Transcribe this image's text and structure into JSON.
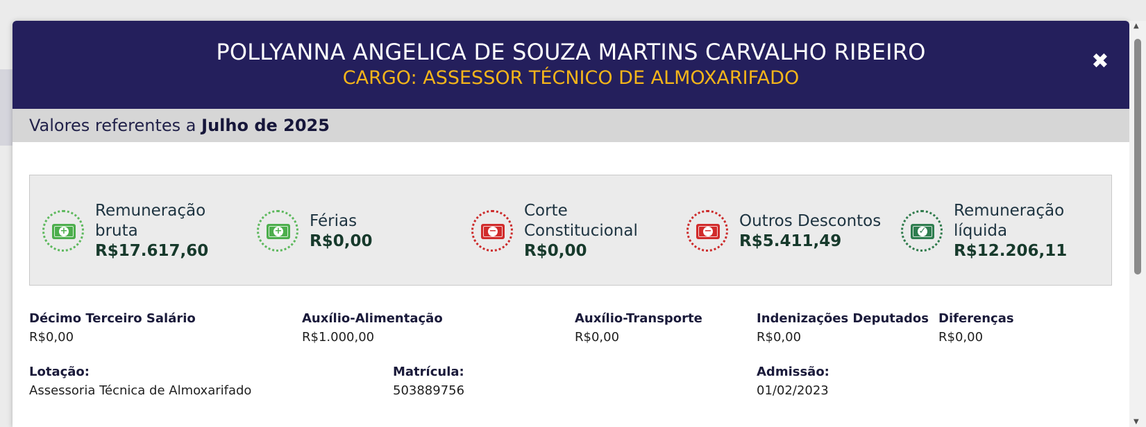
{
  "header": {
    "name": "POLLYANNA ANGELICA DE SOUZA MARTINS CARVALHO RIBEIRO",
    "role": "CARGO: ASSESSOR TÉCNICO DE ALMOXARIFADO"
  },
  "period": {
    "prefix": "Valores referentes a ",
    "month": "Julho de 2025"
  },
  "summary": [
    {
      "label": "Remuneração bruta",
      "value": "R$17.617,60",
      "icon": "money-plus-icon"
    },
    {
      "label": "Férias",
      "value": "R$0,00",
      "icon": "money-plus-icon"
    },
    {
      "label": "Corte Constitucional",
      "value": "R$0,00",
      "icon": "money-minus-icon"
    },
    {
      "label": "Outros Descontos",
      "value": "R$5.411,49",
      "icon": "money-minus-icon"
    },
    {
      "label": "Remuneração líquida",
      "value": "R$12.206,11",
      "icon": "money-check-icon"
    }
  ],
  "extras": [
    {
      "label": "Décimo Terceiro Salário",
      "value": "R$0,00"
    },
    {
      "label": "Auxílio-Alimentação",
      "value": "R$1.000,00"
    },
    {
      "label": "Auxílio-Transporte",
      "value": "R$0,00"
    },
    {
      "label": "Indenizações Deputados",
      "value": "R$0,00"
    },
    {
      "label": "Diferenças",
      "value": "R$0,00"
    }
  ],
  "details": [
    {
      "label": "Lotação:",
      "value": "Assessoria Técnica de Almoxarifado"
    },
    {
      "label": "Matrícula:",
      "value": "503889756"
    },
    {
      "label": "Admissão:",
      "value": "01/02/2023"
    }
  ],
  "colors": {
    "header_bg": "#241f5c",
    "role_text": "#f5b51a",
    "positive": "#4cae4c",
    "negative": "#d12b2b",
    "net": "#2e7d4f"
  }
}
